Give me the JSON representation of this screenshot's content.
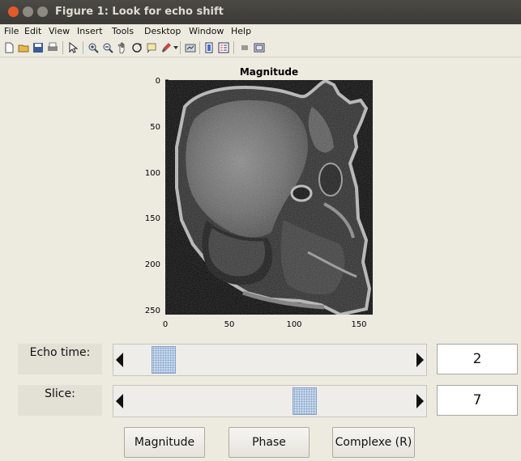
{
  "window": {
    "title": "Figure 1: Look for echo shift"
  },
  "menu": [
    "File",
    "Edit",
    "View",
    "Insert",
    "Tools",
    "Desktop",
    "Window",
    "Help"
  ],
  "toolbar": [
    "new-figure-icon",
    "open-file-icon",
    "save-icon",
    "print-icon",
    "pointer-icon",
    "zoom-in-icon",
    "zoom-out-icon",
    "pan-icon",
    "rotate-icon",
    "data-cursor-icon",
    "brush-icon",
    "link-icon",
    "colorbar-icon",
    "legend-icon",
    "hide-plot-tools-icon",
    "show-plot-tools-icon"
  ],
  "plot": {
    "title": "Magnitude",
    "x_ticks": [
      "0",
      "50",
      "100",
      "150"
    ],
    "y_ticks": [
      "0",
      "50",
      "100",
      "150",
      "200",
      "250"
    ]
  },
  "controls": {
    "echo_label": "Echo time:",
    "echo_value": "2",
    "echo_position": 0.1,
    "slice_label": "Slice:",
    "slice_value": "7",
    "slice_position": 0.63
  },
  "buttons": {
    "magnitude": "Magnitude",
    "phase": "Phase",
    "complexe": "Complexe (R)"
  }
}
